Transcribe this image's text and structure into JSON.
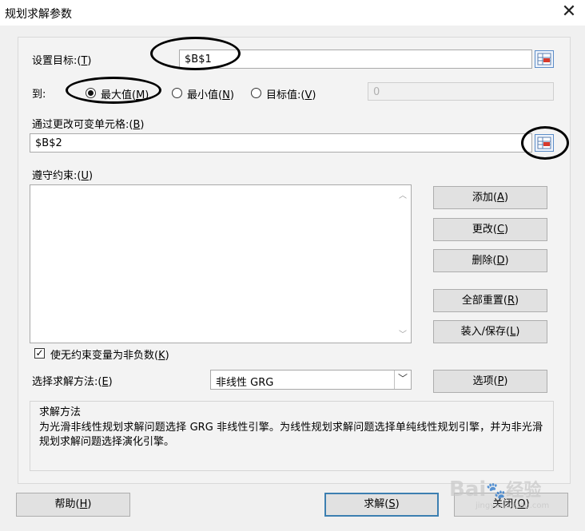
{
  "window": {
    "title": "规划求解参数",
    "close_glyph": "✕"
  },
  "objective": {
    "label": "设置目标:(",
    "key": "T",
    "label_end": ")",
    "value": "$B$1"
  },
  "to": {
    "label": "到:",
    "max": {
      "label": "最大值(",
      "key": "M",
      "end": ")",
      "selected": true
    },
    "min": {
      "label": "最小值(",
      "key": "N",
      "end": ")",
      "selected": false
    },
    "value_of": {
      "label": "目标值:(",
      "key": "V",
      "end": ")",
      "selected": false
    },
    "target_value": "0"
  },
  "changing_cells": {
    "label": "通过更改可变单元格:(",
    "key": "B",
    "label_end": ")",
    "value": "$B$2"
  },
  "constraints": {
    "label": "遵守约束:(",
    "key": "U",
    "label_end": ")",
    "items": []
  },
  "side_buttons": {
    "add": {
      "label": "添加(",
      "key": "A",
      "end": ")"
    },
    "change": {
      "label": "更改(",
      "key": "C",
      "end": ")"
    },
    "delete": {
      "label": "删除(",
      "key": "D",
      "end": ")"
    },
    "reset_all": {
      "label": "全部重置(",
      "key": "R",
      "end": ")"
    },
    "load_save": {
      "label": "装入/保存(",
      "key": "L",
      "end": ")"
    },
    "options": {
      "label": "选项(",
      "key": "P",
      "end": ")"
    }
  },
  "nonneg": {
    "label": "使无约束变量为非负数(",
    "key": "K",
    "end": ")",
    "checked": true
  },
  "method": {
    "label": "选择求解方法:(",
    "key": "E",
    "label_end": ")",
    "selected": "非线性 GRG"
  },
  "solving_method": {
    "title": "求解方法",
    "description": "为光滑非线性规划求解问题选择 GRG 非线性引擎。为线性规划求解问题选择单纯线性规划引擎，并为非光滑规划求解问题选择演化引擎。"
  },
  "bottom_buttons": {
    "help": {
      "label": "帮助(",
      "key": "H",
      "end": ")"
    },
    "solve": {
      "label": "求解(",
      "key": "S",
      "end": ")"
    },
    "close": {
      "label": "关闭(",
      "key": "O",
      "end": ")"
    }
  },
  "watermark": {
    "brand": "Bai",
    "brand2": "经验",
    "site": "jingyan.baidu.com"
  }
}
